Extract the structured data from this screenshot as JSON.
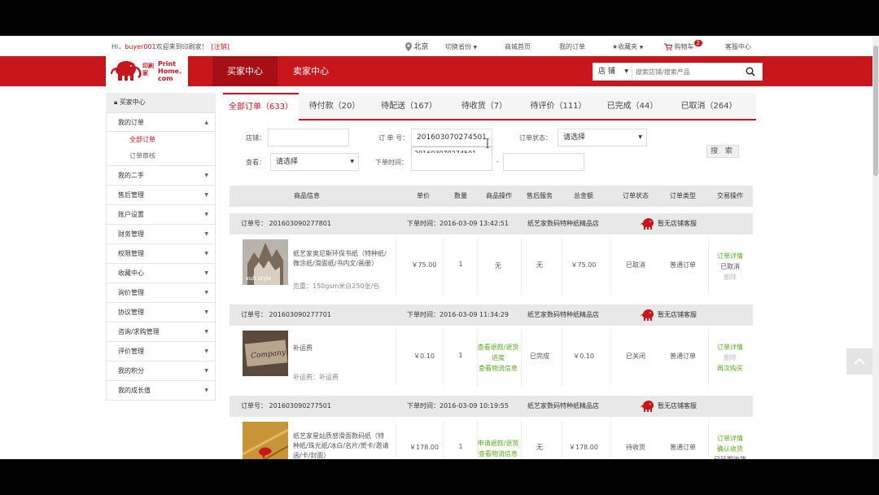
{
  "topbar": {
    "greet_prefix": "Hi，",
    "username": "buyer001",
    "welcome": "欢迎来到印刷家！",
    "logout": "[注销]",
    "city": "北京",
    "switch_city": "切换省份",
    "mall_home": "商城首页",
    "my_orders": "我的订单",
    "favorites": "收藏夹",
    "cart": "购物车",
    "cart_count": "2",
    "service": "客服中心"
  },
  "logo": {
    "cn": "印刷家",
    "en_top": "Print",
    "en_mid": "Home.",
    "en_bot": "com"
  },
  "header": {
    "tabs": [
      {
        "label": "买家中心"
      },
      {
        "label": "卖家中心"
      }
    ],
    "search": {
      "scope": "店 铺",
      "placeholder": "搜索店铺/搜索产品"
    }
  },
  "sidebar": {
    "title": "买家中心",
    "my_orders": "我的订单",
    "sub": [
      {
        "label": "全部订单"
      },
      {
        "label": "订单审核"
      }
    ],
    "items": [
      {
        "label": "我的二手"
      },
      {
        "label": "售后管理"
      },
      {
        "label": "账户设置"
      },
      {
        "label": "财务管理"
      },
      {
        "label": "权限管理"
      },
      {
        "label": "收藏中心"
      },
      {
        "label": "询价管理"
      },
      {
        "label": "协议管理"
      },
      {
        "label": "咨询/求购管理"
      },
      {
        "label": "评价管理"
      },
      {
        "label": "我的积分"
      },
      {
        "label": "我的成长值"
      }
    ]
  },
  "tabs": [
    {
      "label": "全部订单（633）"
    },
    {
      "label": "待付款（20）"
    },
    {
      "label": "待配送（167）"
    },
    {
      "label": "待收货（7）"
    },
    {
      "label": "待评价（111）"
    },
    {
      "label": "已完成（44）"
    },
    {
      "label": "已取消（264）"
    }
  ],
  "filter": {
    "store_label": "店铺：",
    "order_no_label": "订 单 号：",
    "order_no_value": "201603070274501",
    "order_no_suggest": "201603070274501",
    "status_label": "订单状态：",
    "status_value": "请选择",
    "view_label": "查看：",
    "view_value": "请选择",
    "time_label": "下单时间：",
    "time_sep": "-",
    "search_btn": "搜 索"
  },
  "columns": [
    "商品信息",
    "单价",
    "数量",
    "商品操作",
    "售后服务",
    "总金额",
    "订单状态",
    "订单类型",
    "交易操作"
  ],
  "orders": [
    {
      "order_no": "订单号： 201603090277801",
      "time": "下单时间：2016-03-09 13:42:51",
      "store": "纸艺家数码特种纸精品店",
      "service": "暂无店铺客服",
      "product": "纸艺家奥尼斯环保书纸（特种纸/微涂纸/滑面纸/书内文/画册）",
      "spec": "克重：150gsm米白250张/包",
      "price": "￥75.00",
      "qty": "1",
      "goods_op": [
        "无"
      ],
      "after_sale": "无",
      "total": "￥75.00",
      "status": "已取消",
      "type": "普通订单",
      "actions": [
        "订单详情",
        "已取消",
        "删除"
      ]
    },
    {
      "order_no": "订单号： 201603090277701",
      "time": "下单时间：2016-03-09 11:34:29",
      "store": "纸艺家数码特种纸精品店",
      "service": "暂无店铺客服",
      "product": "补运费",
      "spec": "补运费：补运费",
      "price": "￥0.10",
      "qty": "1",
      "goods_op": [
        "查看退款/退货",
        "进度",
        "查看物流信息"
      ],
      "after_sale": "已完成",
      "total": "￥0.10",
      "status": "已关闭",
      "type": "普通订单",
      "actions": [
        "订单详情",
        "删除",
        "再次购买"
      ]
    },
    {
      "order_no": "订单号： 201603090277501",
      "time": "下单时间：2016-03-09 10:19:55",
      "store": "纸艺家数码特种纸精品店",
      "service": "暂无店铺客服",
      "product": "纸艺家星灿质感滑面数码纸（特种纸/珠光纸/冰白/名片/贺卡/邀请函/卡/封面）",
      "spec": "",
      "price": "￥178.00",
      "qty": "1",
      "goods_op": [
        "申请退款/退货",
        "查看物流信息"
      ],
      "after_sale": "无",
      "total": "￥178.00",
      "status": "待收货",
      "type": "普通订单",
      "actions": [
        "订单详情",
        "确认收货",
        "已延期收货"
      ]
    }
  ],
  "colors": {
    "brand": "#c8161d",
    "link_green": "#5aa81e"
  }
}
